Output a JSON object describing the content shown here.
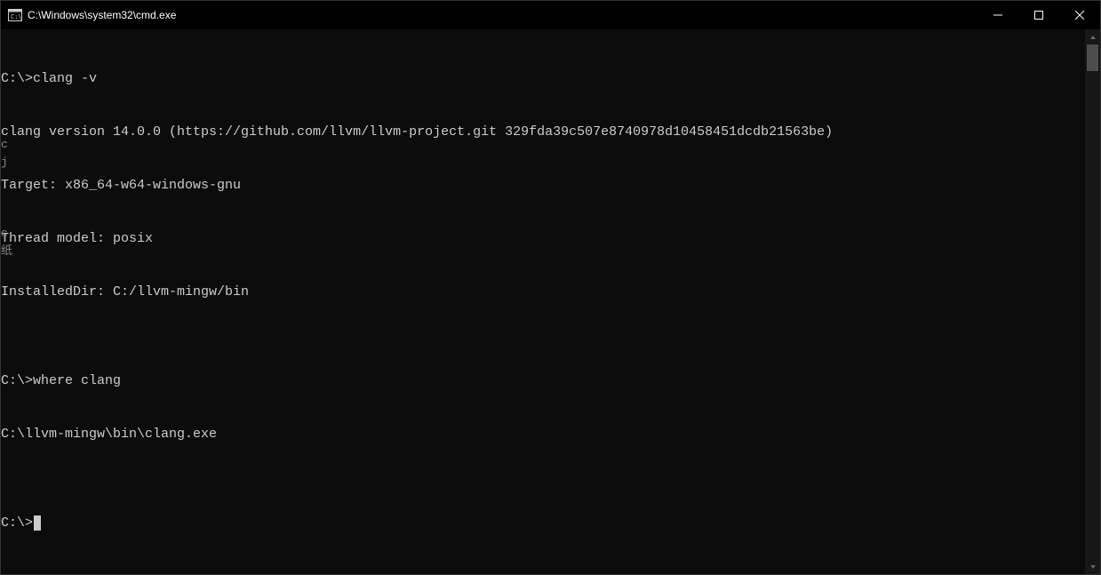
{
  "window": {
    "title": "C:\\Windows\\system32\\cmd.exe"
  },
  "terminal": {
    "lines": [
      "C:\\>clang -v",
      "clang version 14.0.0 (https://github.com/llvm/llvm-project.git 329fda39c507e8740978d10458451dcdb21563be)",
      "Target: x86_64-w64-windows-gnu",
      "Thread model: posix",
      "InstalledDir: C:/llvm-mingw/bin",
      "",
      "C:\\>where clang",
      "C:\\llvm-mingw\\bin\\clang.exe",
      "",
      "C:\\>"
    ],
    "prompt": "C:\\>",
    "commands": [
      "clang -v",
      "where clang"
    ],
    "output": {
      "clang_version": "clang version 14.0.0 (https://github.com/llvm/llvm-project.git 329fda39c507e8740978d10458451dcdb21563be)",
      "target": "Target: x86_64-w64-windows-gnu",
      "thread_model": "Thread model: posix",
      "installed_dir": "InstalledDir: C:/llvm-mingw/bin",
      "where_result": "C:\\llvm-mingw\\bin\\clang.exe"
    }
  },
  "left_artifacts": [
    "c",
    "j",
    "",
    "",
    "",
    "c",
    "纸"
  ]
}
